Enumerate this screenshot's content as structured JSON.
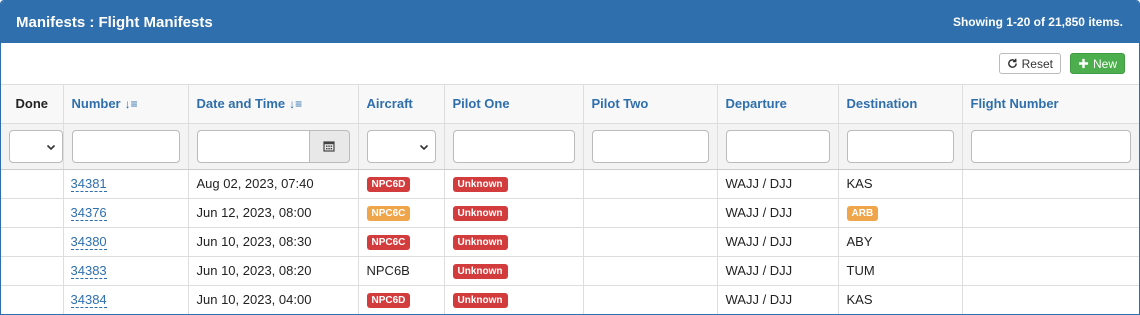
{
  "header": {
    "title": "Manifests : Flight Manifests",
    "summary": "Showing 1-20 of 21,850 items."
  },
  "toolbar": {
    "reset_label": "Reset",
    "new_label": "New"
  },
  "columns": {
    "done": "Done",
    "number": "Number",
    "datetime": "Date and Time",
    "aircraft": "Aircraft",
    "pilot_one": "Pilot One",
    "pilot_two": "Pilot Two",
    "departure": "Departure",
    "destination": "Destination",
    "flight_number": "Flight Number"
  },
  "colors": {
    "primary": "#2f6fad",
    "danger": "#d33c3c",
    "warning": "#efa54a",
    "success": "#4cae4c"
  },
  "rows": [
    {
      "number": "34381",
      "datetime": "Aug 02, 2023, 07:40",
      "aircraft": {
        "text": "NPC6D",
        "style": "danger"
      },
      "pilot_one": {
        "text": "Unknown",
        "style": "danger"
      },
      "pilot_two": "",
      "departure": "WAJJ / DJJ",
      "destination": {
        "text": "KAS",
        "style": "plain"
      },
      "flight_number": ""
    },
    {
      "number": "34376",
      "datetime": "Jun 12, 2023, 08:00",
      "aircraft": {
        "text": "NPC6C",
        "style": "warning"
      },
      "pilot_one": {
        "text": "Unknown",
        "style": "danger"
      },
      "pilot_two": "",
      "departure": "WAJJ / DJJ",
      "destination": {
        "text": "ARB",
        "style": "warning"
      },
      "flight_number": ""
    },
    {
      "number": "34380",
      "datetime": "Jun 10, 2023, 08:30",
      "aircraft": {
        "text": "NPC6C",
        "style": "danger"
      },
      "pilot_one": {
        "text": "Unknown",
        "style": "danger"
      },
      "pilot_two": "",
      "departure": "WAJJ / DJJ",
      "destination": {
        "text": "ABY",
        "style": "plain"
      },
      "flight_number": ""
    },
    {
      "number": "34383",
      "datetime": "Jun 10, 2023, 08:20",
      "aircraft": {
        "text": "NPC6B",
        "style": "plain"
      },
      "pilot_one": {
        "text": "Unknown",
        "style": "danger"
      },
      "pilot_two": "",
      "departure": "WAJJ / DJJ",
      "destination": {
        "text": "TUM",
        "style": "plain"
      },
      "flight_number": ""
    },
    {
      "number": "34384",
      "datetime": "Jun 10, 2023, 04:00",
      "aircraft": {
        "text": "NPC6D",
        "style": "danger"
      },
      "pilot_one": {
        "text": "Unknown",
        "style": "danger"
      },
      "pilot_two": "",
      "departure": "WAJJ / DJJ",
      "destination": {
        "text": "KAS",
        "style": "plain"
      },
      "flight_number": ""
    }
  ]
}
